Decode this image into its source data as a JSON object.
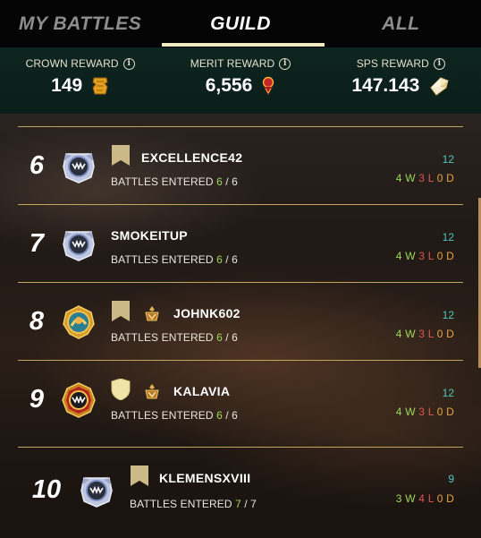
{
  "tabs": [
    {
      "label": "MY BATTLES",
      "active": false
    },
    {
      "label": "GUILD",
      "active": true
    },
    {
      "label": "ALL",
      "active": false
    }
  ],
  "rewards": [
    {
      "label": "CROWN REWARD",
      "value": "149",
      "icon": "crown-token-icon"
    },
    {
      "label": "MERIT REWARD",
      "value": "6,556",
      "icon": "merit-medal-icon"
    },
    {
      "label": "SPS REWARD",
      "value": "147.143",
      "icon": "sps-crystal-icon"
    }
  ],
  "info_glyph": "i",
  "rows": [
    {
      "rank": "6",
      "name": "EXCELLENCE42",
      "entered_label": "BATTLES ENTERED",
      "entered": "6",
      "total": "6",
      "score": "12",
      "wins": "4",
      "losses": "3",
      "draws": "0",
      "w": "W",
      "l": "L",
      "d": "D",
      "has_flag": true,
      "flag_type": "banner",
      "has_badge": false,
      "emblem": "silver"
    },
    {
      "rank": "7",
      "name": "SMOKEITUP",
      "entered_label": "BATTLES ENTERED",
      "entered": "6",
      "total": "6",
      "score": "12",
      "wins": "4",
      "losses": "3",
      "draws": "0",
      "w": "W",
      "l": "L",
      "d": "D",
      "has_flag": false,
      "has_badge": false,
      "emblem": "silver"
    },
    {
      "rank": "8",
      "name": "JOHNK602",
      "entered_label": "BATTLES ENTERED",
      "entered": "6",
      "total": "6",
      "score": "12",
      "wins": "4",
      "losses": "3",
      "draws": "0",
      "w": "W",
      "l": "L",
      "d": "D",
      "has_flag": true,
      "flag_type": "banner",
      "has_badge": true,
      "emblem": "gold-teal"
    },
    {
      "rank": "9",
      "name": "KALAVIA",
      "entered_label": "BATTLES ENTERED",
      "entered": "6",
      "total": "6",
      "score": "12",
      "wins": "4",
      "losses": "3",
      "draws": "0",
      "w": "W",
      "l": "L",
      "d": "D",
      "has_flag": true,
      "flag_type": "shield",
      "has_badge": true,
      "emblem": "gold-red"
    },
    {
      "rank": "10",
      "name": "KLEMENSXVIII",
      "entered_label": "BATTLES ENTERED",
      "entered": "7",
      "total": "7",
      "score": "9",
      "wins": "3",
      "losses": "4",
      "draws": "0",
      "w": "W",
      "l": "L",
      "d": "D",
      "has_flag": true,
      "flag_type": "banner",
      "has_badge": false,
      "emblem": "silver"
    }
  ],
  "colors": {
    "accent": "#f2eac4",
    "wins": "#9bd65a",
    "losses": "#e05551",
    "draws": "#e6a343",
    "score": "#4fc6bf",
    "divider": "#c2a45e"
  }
}
